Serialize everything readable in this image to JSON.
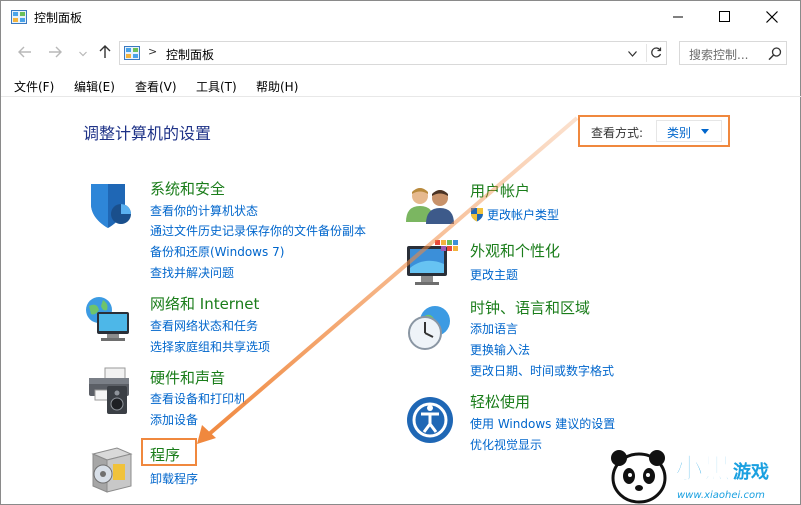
{
  "window": {
    "title": "控制面板",
    "minimize_glyph": "minimize-icon",
    "maximize_glyph": "maximize-icon",
    "close_glyph": "close-icon"
  },
  "address": {
    "separator": ">",
    "path": "控制面板"
  },
  "search": {
    "placeholder": "搜索控制..."
  },
  "menu": {
    "items": [
      "文件(F)",
      "编辑(E)",
      "查看(V)",
      "工具(T)",
      "帮助(H)"
    ]
  },
  "main": {
    "heading": "调整计算机的设置",
    "view_mode": {
      "label": "查看方式:",
      "value": "类别"
    },
    "categories": [
      {
        "title": "系统和安全",
        "links": [
          "查看你的计算机状态",
          "通过文件历史记录保存你的文件备份副本",
          "备份和还原(Windows 7)",
          "查找并解决问题"
        ]
      },
      {
        "title": "网络和 Internet",
        "links": [
          "查看网络状态和任务",
          "选择家庭组和共享选项"
        ]
      },
      {
        "title": "硬件和声音",
        "links": [
          "查看设备和打印机",
          "添加设备"
        ]
      },
      {
        "title": "程序",
        "links": [
          "卸载程序"
        ]
      },
      {
        "title": "用户帐户",
        "links": [
          "更改帐户类型"
        ]
      },
      {
        "title": "外观和个性化",
        "links": [
          "更改主题"
        ]
      },
      {
        "title": "时钟、语言和区域",
        "links": [
          "添加语言",
          "更换输入法",
          "更改日期、时间或数字格式"
        ]
      },
      {
        "title": "轻松使用",
        "links": [
          "使用 Windows 建议的设置",
          "优化视觉显示"
        ]
      }
    ]
  },
  "watermark": {
    "logo_text": "小黑游戏",
    "url": "www.xiaohei.com"
  },
  "colors": {
    "accent": "#0066cc",
    "category_green": "#1a7d1a",
    "heading_blue": "#1e3287",
    "annotation_orange": "#f0883e"
  }
}
